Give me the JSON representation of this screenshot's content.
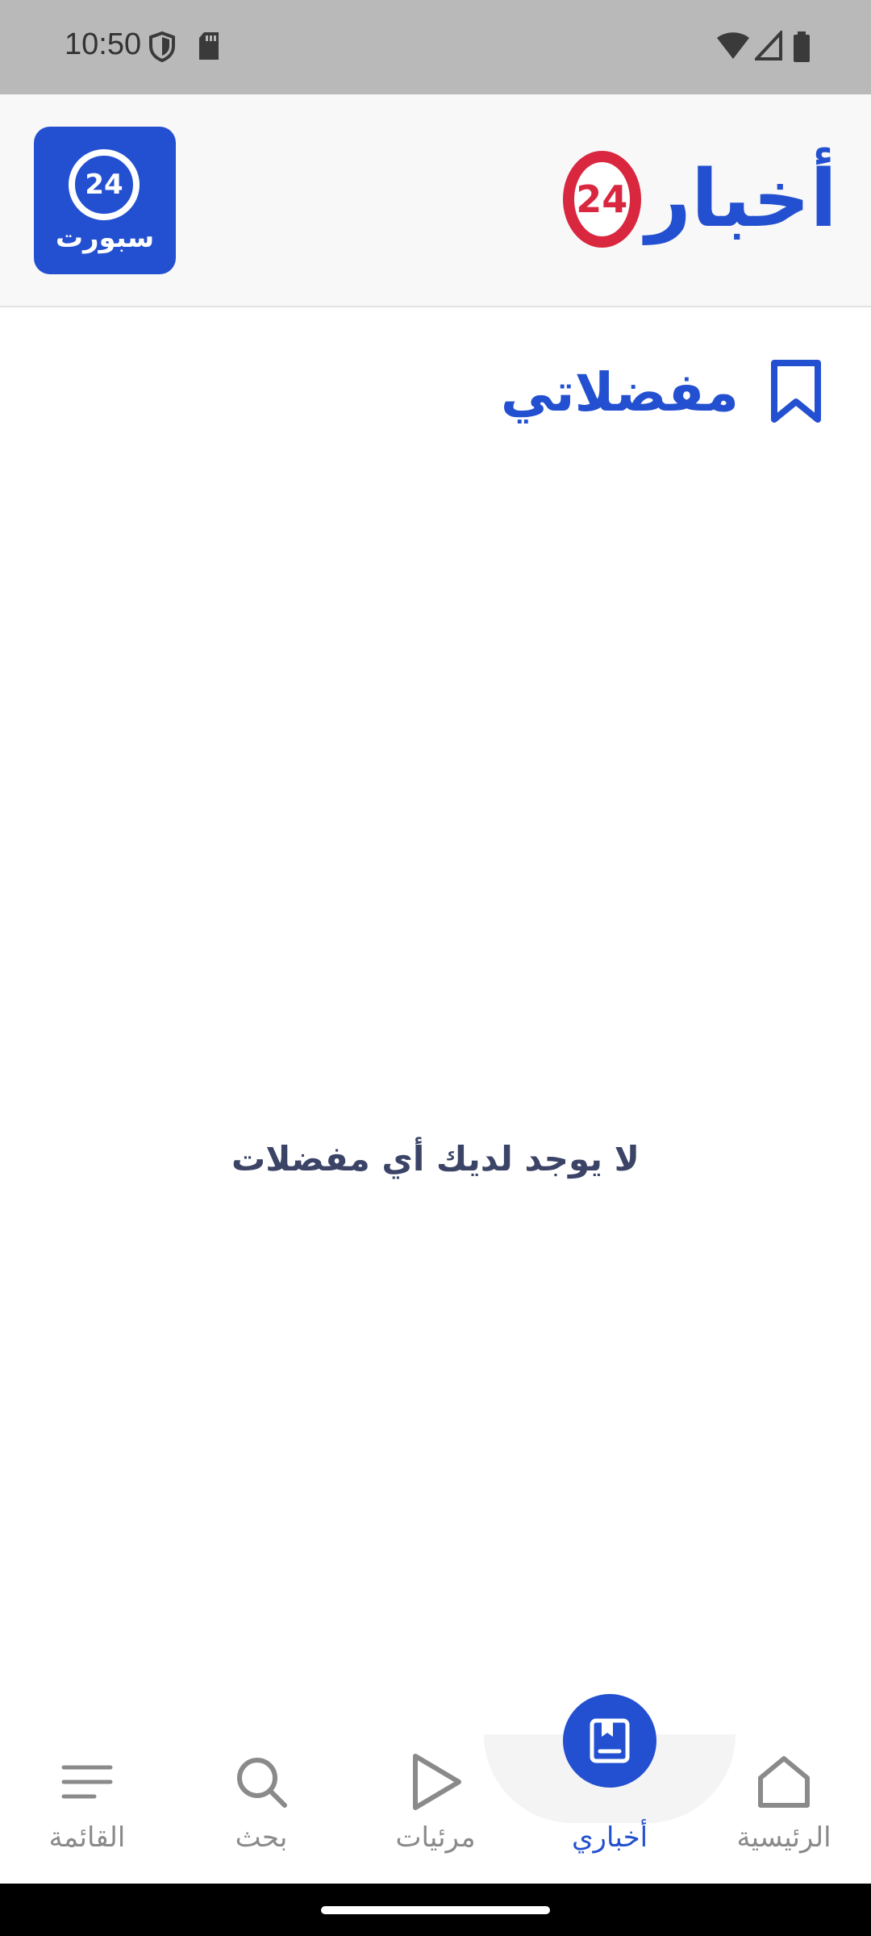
{
  "status_bar": {
    "time": "10:50"
  },
  "header": {
    "brand_name": "أخبار",
    "brand_number": "24",
    "sport_badge_number": "24",
    "sport_badge_label": "سبورت",
    "brand_color": "#2350d0",
    "brand_accent": "#d9273f"
  },
  "page": {
    "title": "مفضلاتي",
    "empty_message": "لا يوجد لديك أي مفضلات"
  },
  "bottom_nav": {
    "items": [
      {
        "label": "القائمة",
        "icon": "menu-icon"
      },
      {
        "label": "بحث",
        "icon": "search-icon"
      },
      {
        "label": "مرئيات",
        "icon": "play-icon"
      },
      {
        "label": "أخباري",
        "icon": "bookmark-book-icon",
        "active": true
      },
      {
        "label": "الرئيسية",
        "icon": "home-icon"
      }
    ]
  }
}
